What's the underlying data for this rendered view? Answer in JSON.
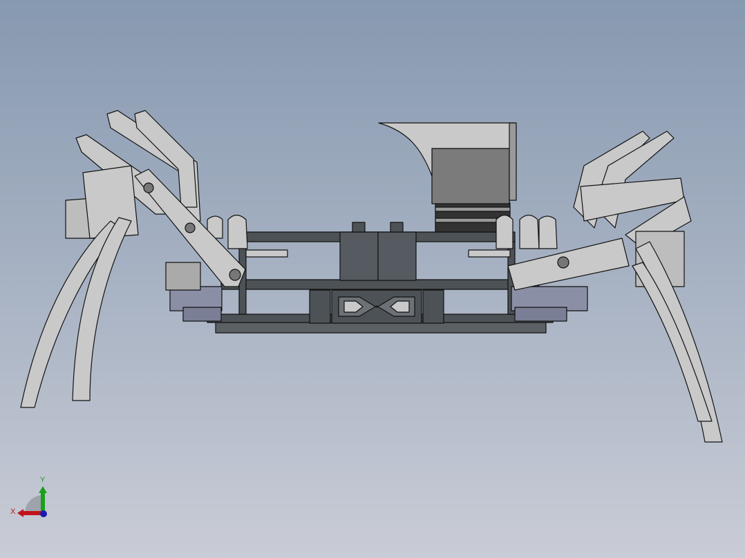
{
  "viewport": {
    "triad": {
      "x_label": "X",
      "y_label": "Y",
      "x_color": "#c0141a",
      "y_color": "#1aa01a",
      "z_color": "#1a1ab0"
    }
  },
  "colors": {
    "part_light": "#c9c9c9",
    "part_dark": "#4c5256",
    "servo_blue": "#8a8fa6",
    "edge": "#111111"
  }
}
